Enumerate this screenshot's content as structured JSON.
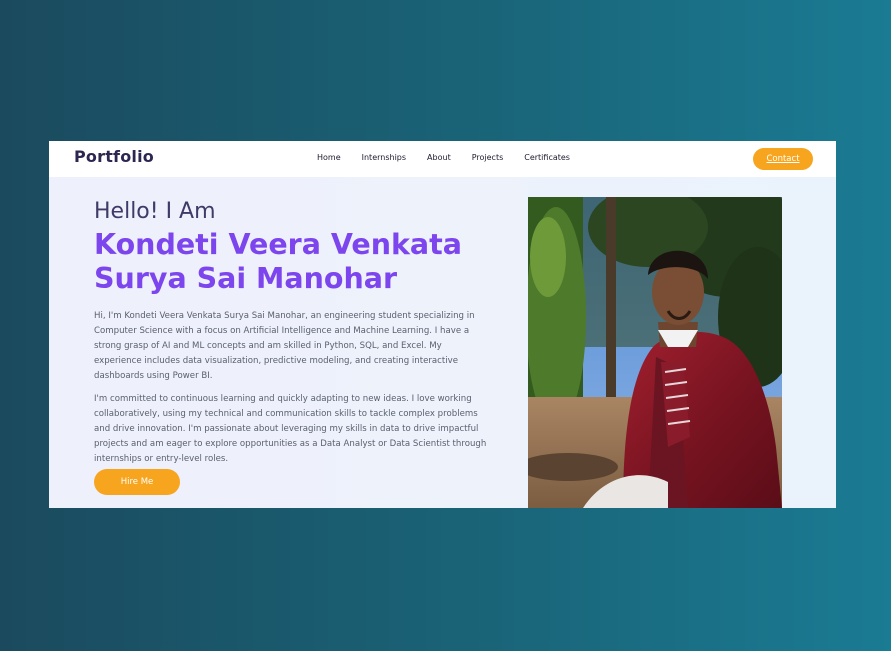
{
  "navbar": {
    "logo": "Portfolio",
    "links": [
      "Home",
      "Internships",
      "About",
      "Projects",
      "Certificates"
    ],
    "contact_label": "Contact"
  },
  "hero": {
    "greeting": "Hello! I Am",
    "name": "Kondeti Veera Venkata Surya Sai Manohar",
    "paragraph1": "Hi, I'm Kondeti Veera Venkata Surya Sai Manohar, an engineering student specializing in Computer Science with a focus on Artificial Intelligence and Machine Learning. I have a strong grasp of AI and ML concepts and am skilled in Python, SQL, and Excel. My experience includes data visualization, predictive modeling, and creating interactive dashboards using Power BI.",
    "paragraph2": "I'm committed to continuous learning and quickly adapting to new ideas. I love working collaboratively, using my technical and communication skills to tackle complex problems and drive innovation. I'm passionate about leveraging my skills in data to drive impactful projects and am eager to explore opportunities as a Data Analyst or Data Scientist through internships or entry-level roles.",
    "hire_label": "Hire Me"
  },
  "colors": {
    "accent": "#7c45ee",
    "button": "#f7a51e",
    "logo": "#2c2650"
  }
}
